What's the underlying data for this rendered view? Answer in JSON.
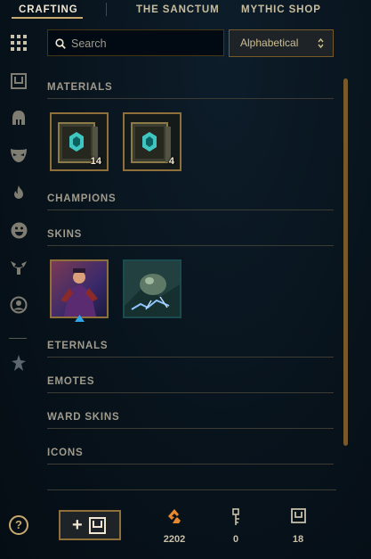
{
  "nav": {
    "tabs": [
      {
        "label": "CRAFTING",
        "active": true
      },
      {
        "label": "THE SANCTUM",
        "active": false
      },
      {
        "label": "MYTHIC SHOP",
        "active": false
      }
    ]
  },
  "sidebar": {
    "icons": [
      "grid-icon",
      "chest-icon",
      "helmet-icon",
      "mask-icon",
      "flame-icon",
      "emote-face-icon",
      "ward-icon",
      "profile-icon",
      "rank-emblem-icon"
    ]
  },
  "search": {
    "placeholder": "Search",
    "value": ""
  },
  "sort": {
    "selected": "Alphabetical"
  },
  "sections": {
    "materials": "MATERIALS",
    "champions": "CHAMPIONS",
    "skins": "SKINS",
    "eternals": "ETERNALS",
    "emotes": "EMOTES",
    "ward_skins": "WARD SKINS",
    "icons": "ICONS"
  },
  "materials": [
    {
      "name": "hextech-chest",
      "count": "14"
    },
    {
      "name": "hextech-chest",
      "count": "4"
    }
  ],
  "skins": [
    {
      "name": "skin-shard-1",
      "upgradeable": true
    },
    {
      "name": "skin-shard-2",
      "upgradeable": false
    }
  ],
  "footer": {
    "help_label": "?",
    "add_chest_label": "+",
    "currencies": [
      {
        "name": "orange-essence",
        "value": "2202"
      },
      {
        "name": "key",
        "value": "0"
      },
      {
        "name": "chest",
        "value": "18"
      }
    ]
  },
  "colors": {
    "gold": "#c8aa6e",
    "orange_essence": "#e8892f",
    "bg": "#08131c"
  }
}
